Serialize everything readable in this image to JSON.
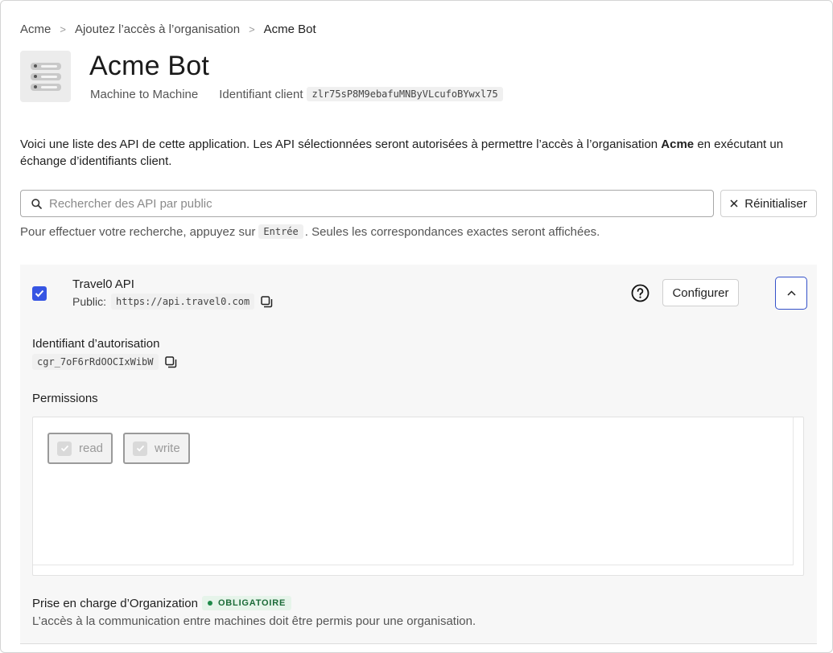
{
  "breadcrumb": {
    "items": [
      "Acme",
      "Ajoutez l’accès à l’organisation",
      "Acme Bot"
    ],
    "separator": ">"
  },
  "header": {
    "title": "Acme Bot",
    "app_type": "Machine to Machine",
    "client_id_label": "Identifiant client",
    "client_id": "zlr75sP8M9ebafuMNByVLcufoBYwxl75"
  },
  "intro": {
    "before": "Voici une liste des API de cette application. Les API sélectionnées seront autorisées à permettre l’accès à l’organisation ",
    "org": "Acme",
    "after": " en exécutant un échange d’identifiants client."
  },
  "search": {
    "placeholder": "Rechercher des API par public",
    "value": "",
    "reset_label": "Réinitialiser",
    "hint_before": "Pour effectuer votre recherche, appuyez sur",
    "hint_key": "Entrée",
    "hint_after": ". Seules les correspondances exactes seront affichées."
  },
  "api": {
    "checked": true,
    "name": "Travel0 API",
    "public_label": "Public:",
    "public_value": "https://api.travel0.com",
    "configure_label": "Configurer",
    "auth_id_label": "Identifiant d’autorisation",
    "auth_id": "cgr_7oF6rRdOOCIxWibW",
    "permissions_label": "Permissions",
    "permissions": [
      {
        "label": "read",
        "checked": true,
        "disabled": true
      },
      {
        "label": "write",
        "checked": true,
        "disabled": true
      }
    ],
    "org_support_label": "Prise en charge d’Organization",
    "org_support_badge": "OBLIGATOIRE",
    "org_support_desc": "L’accès à la communication entre machines doit être permis pour une organisation."
  },
  "colors": {
    "accent": "#3655e3",
    "badge_bg": "#e6f4ea",
    "badge_text": "#1b6b38"
  }
}
